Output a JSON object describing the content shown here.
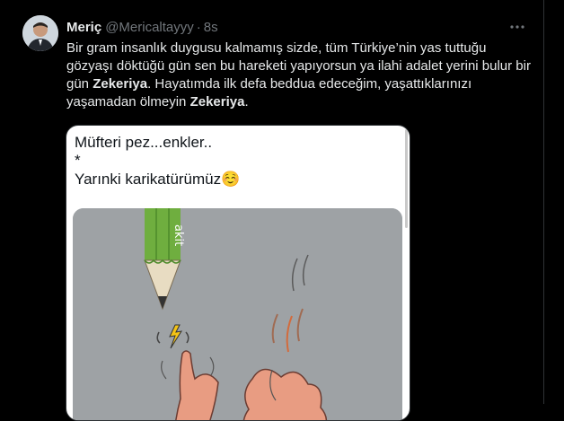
{
  "author": {
    "name": "Meriç",
    "handle": "@Mericaltayyy",
    "separator": "·",
    "time": "8s"
  },
  "tweet": {
    "segments": [
      "Bir gram insanlık duygusu kalmamış sizde, tüm Türkiye’nin yas tuttuğu gözyaşı döktüğü gün sen bu hareketi yapıyorsun ya ilahi adalet yerini bulur bir gün ",
      "Zekeriya",
      ". Hayatımda ilk defa beddua edeceğim, yaşattıklarınızı yaşamadan ölmeyin ",
      "Zekeriya",
      "."
    ]
  },
  "media": {
    "line1": "Müfteri pez...enkler..",
    "line2": "*",
    "line3": "Yarınki karikatürümüz☺️",
    "pencil_text": "akit"
  },
  "colors": {
    "background": "#000000",
    "text": "#e7e9ea",
    "secondary": "#71767b",
    "divider": "#2f3336",
    "pencil_green": "#6fae3f"
  },
  "icons": {
    "more": "more-icon",
    "avatar": "avatar"
  }
}
